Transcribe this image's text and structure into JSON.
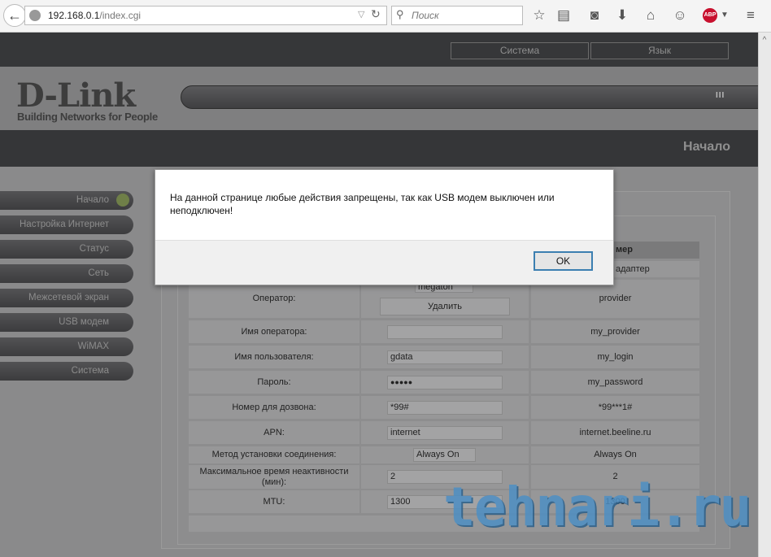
{
  "browser": {
    "url_host": "192.168.0.1",
    "url_path": "/index.cgi",
    "search_placeholder": "Поиск",
    "abp": "ABP"
  },
  "header": {
    "buttons": [
      "Система",
      "Язык"
    ]
  },
  "logo": {
    "name": "D-Link",
    "tagline": "Building Networks for People"
  },
  "page_title": "Начало",
  "sidebar": {
    "items": [
      "Начало",
      "Настройка Интернет",
      "Статус",
      "Сеть",
      "Межсетевой экран",
      "USB модем",
      "WiMAX",
      "Система"
    ]
  },
  "table": {
    "header_example": "мер",
    "row0_example": "адаптер",
    "rows": [
      {
        "label": "Оператор:",
        "value": "megaton",
        "button": "Удалить",
        "example": "provider"
      },
      {
        "label": "Имя оператора:",
        "value": "",
        "example": "my_provider"
      },
      {
        "label": "Имя пользователя:",
        "value": "gdata",
        "example": "my_login"
      },
      {
        "label": "Пароль:",
        "value": "●●●●●",
        "example": "my_password"
      },
      {
        "label": "Номер для дозвона:",
        "value": "*99#",
        "example": "*99***1#"
      },
      {
        "label": "APN:",
        "value": "internet",
        "example": "internet.beeline.ru"
      },
      {
        "label": "Метод установки соединения:",
        "value": "Always On",
        "example": "Always On"
      },
      {
        "label": "Максимальное время неактивности (мин):",
        "value": "2",
        "example": "2"
      },
      {
        "label": "MTU:",
        "value": "1300",
        "example": "1300"
      }
    ]
  },
  "dialog": {
    "message": "На данной странице любые действия запрещены, так как USB модем выключен или неподключен!",
    "ok": "OK"
  },
  "watermark": "tehnari.ru"
}
